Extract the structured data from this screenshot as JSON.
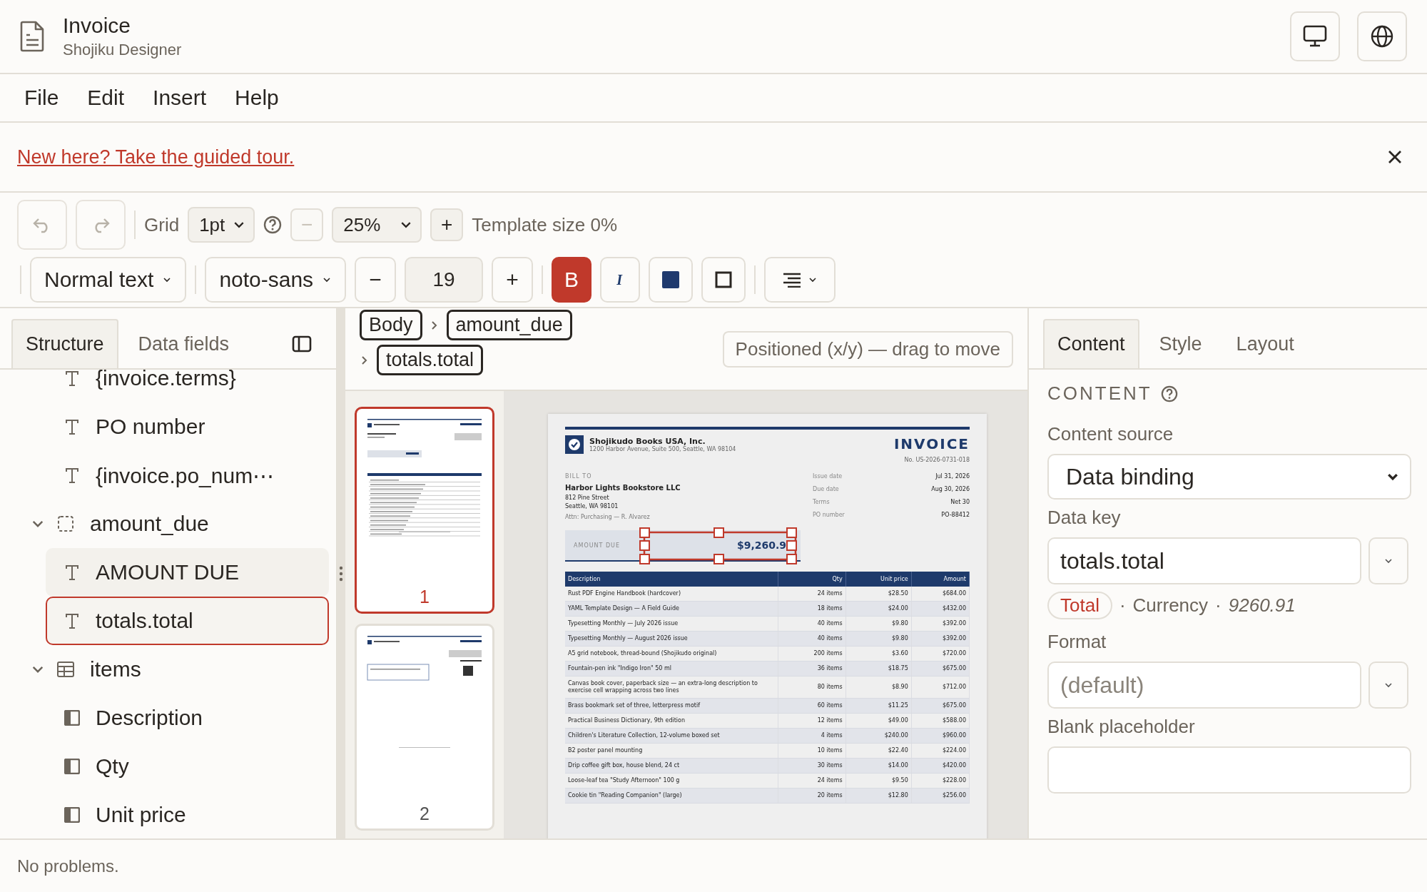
{
  "window": {
    "title": "Invoice",
    "subtitle": "Shojiku Designer"
  },
  "menu": [
    "File",
    "Edit",
    "Insert",
    "Help"
  ],
  "banner": {
    "link": "New here? Take the guided tour."
  },
  "toolbar": {
    "undo": {
      "disabled": true
    },
    "redo": {
      "disabled": true
    },
    "grid_label": "Grid",
    "grid": "1pt",
    "zoom_out": {
      "label": "−",
      "disabled": true
    },
    "zoom": "25%",
    "zoom_in": {
      "label": "+",
      "disabled": false
    },
    "template_size": "Template size 0%",
    "text_style": "Normal text",
    "font": "noto-sans",
    "size_down": "−",
    "font_size": "19",
    "size_up": "+",
    "bold": {
      "label": "B",
      "on": true
    },
    "italic": {
      "label": "I",
      "on": false
    }
  },
  "left_panel": {
    "tabs": [
      {
        "label": "Structure",
        "selected": true
      },
      {
        "label": "Data fields",
        "selected": false
      }
    ],
    "tree": [
      {
        "children": [
          {
            "kind": "text",
            "label": "{invoice.terms}",
            "selected": false,
            "hovered": false
          },
          {
            "kind": "text",
            "label": "PO number",
            "selected": false,
            "hovered": false
          },
          {
            "kind": "text",
            "label": "{invoice.po_num⋯",
            "selected": false,
            "hovered": false
          }
        ]
      },
      {
        "kind": "group",
        "label": "amount_due",
        "expanded": true,
        "selected": false,
        "hovered": false,
        "children": [
          {
            "kind": "text",
            "label": "AMOUNT DUE",
            "selected": false,
            "hovered": true
          },
          {
            "kind": "text",
            "label": "totals.total",
            "selected": true,
            "hovered": false
          }
        ]
      },
      {
        "kind": "table",
        "label": "items",
        "expanded": true,
        "selected": false,
        "hovered": false,
        "children": [
          {
            "kind": "column",
            "label": "Description",
            "selected": false,
            "hovered": false
          },
          {
            "kind": "column",
            "label": "Qty",
            "selected": false,
            "hovered": false
          },
          {
            "kind": "column",
            "label": "Unit price",
            "selected": false,
            "hovered": false
          }
        ]
      }
    ]
  },
  "breadcrumb": [
    "Body",
    "amount_due",
    "totals.total"
  ],
  "position_hint": "Positioned (x/y) — drag to move",
  "pages": [
    {
      "number": "1",
      "selected": true
    },
    {
      "number": "2",
      "selected": false
    }
  ],
  "invoice": {
    "company": "Shojikudo Books USA, Inc.",
    "company_address": "1200 Harbor Avenue, Suite 500, Seattle, WA 98104",
    "title": "INVOICE",
    "number": "No. US-2026-0731-018",
    "bill_to_label": "BILL TO",
    "customer": "Harbor Lights Bookstore LLC",
    "customer_address": [
      "812 Pine Street",
      "Seattle, WA 98101"
    ],
    "attention": "Attn: Purchasing — R. Alvarez",
    "meta": [
      {
        "label": "Issue date",
        "value": "Jul 31, 2026"
      },
      {
        "label": "Due date",
        "value": "Aug 30, 2026"
      },
      {
        "label": "Terms",
        "value": "Net 30"
      },
      {
        "label": "PO number",
        "value": "PO-88412"
      }
    ],
    "amount_due": {
      "label": "AMOUNT DUE",
      "value": "$9,260.9",
      "selected": true
    },
    "columns": [
      "Description",
      "Qty",
      "Unit price",
      "Amount"
    ],
    "rows": [
      [
        "Rust PDF Engine Handbook (hardcover)",
        "24 items",
        "$28.50",
        "$684.00"
      ],
      [
        "YAML Template Design — A Field Guide",
        "18 items",
        "$24.00",
        "$432.00"
      ],
      [
        "Typesetting Monthly — July 2026 issue",
        "40 items",
        "$9.80",
        "$392.00"
      ],
      [
        "Typesetting Monthly — August 2026 issue",
        "40 items",
        "$9.80",
        "$392.00"
      ],
      [
        "A5 grid notebook, thread-bound (Shojikudo original)",
        "200 items",
        "$3.60",
        "$720.00"
      ],
      [
        "Fountain-pen ink \"Indigo Iron\" 50 ml",
        "36 items",
        "$18.75",
        "$675.00"
      ],
      [
        "Canvas book cover, paperback size — an extra-long description to exercise cell wrapping across two lines",
        "80 items",
        "$8.90",
        "$712.00"
      ],
      [
        "Brass bookmark set of three, letterpress motif",
        "60 items",
        "$11.25",
        "$675.00"
      ],
      [
        "Practical Business Dictionary, 9th edition",
        "12 items",
        "$49.00",
        "$588.00"
      ],
      [
        "Children's Literature Collection, 12-volume boxed set",
        "4 items",
        "$240.00",
        "$960.00"
      ],
      [
        "B2 poster panel mounting",
        "10 items",
        "$22.40",
        "$224.00"
      ],
      [
        "Drip coffee gift box, house blend, 24 ct",
        "30 items",
        "$14.00",
        "$420.00"
      ],
      [
        "Loose-leaf tea \"Study Afternoon\" 100 g",
        "24 items",
        "$9.50",
        "$228.00"
      ],
      [
        "Cookie tin \"Reading Companion\" (large)",
        "20 items",
        "$12.80",
        "$256.00"
      ]
    ]
  },
  "inspector": {
    "tabs": [
      {
        "label": "Content",
        "selected": true
      },
      {
        "label": "Style",
        "selected": false
      },
      {
        "label": "Layout",
        "selected": false
      }
    ],
    "section": "CONTENT",
    "source_label": "Content source",
    "source": "Data binding",
    "key_label": "Data key",
    "key": "totals.total",
    "key_tag": "Total",
    "key_type": "Currency",
    "separator": "·",
    "key_sample": "9260.91",
    "format_label": "Format",
    "format_placeholder": "(default)",
    "blank_label": "Blank placeholder"
  },
  "status": "No problems."
}
